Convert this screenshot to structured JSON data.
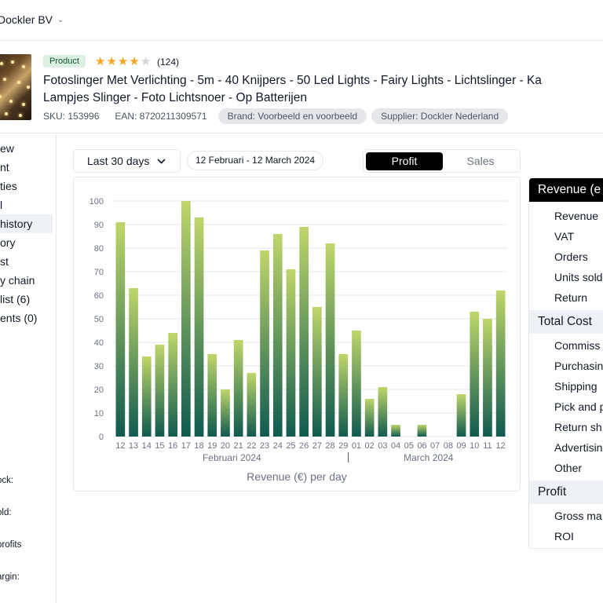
{
  "topbar": {
    "company": "Dockler BV"
  },
  "product": {
    "badge": "Product",
    "rating": 4,
    "rating_max": 5,
    "reviews": "(124)",
    "title_line1": "Fotoslinger Met Verlichting - 5m - 40 Knijpers - 50 Led Lights - Fairy Lights - Lichtslinger - Ka",
    "title_line2": "Lampjes Slinger - Foto Lichtsnoer - Op Batterijen",
    "sku": "SKU: 153996",
    "ean": "EAN: 8720211309571",
    "brand": "Brand: Voorbeeld en voorbeeld",
    "supplier": "Supplier: Dockler Nederland"
  },
  "sidebar": {
    "items": [
      {
        "label": "ew"
      },
      {
        "label": "nt"
      },
      {
        "label": "ties"
      },
      {
        "label": "l"
      },
      {
        "label": "history",
        "active": true
      },
      {
        "label": "ory"
      },
      {
        "label": "st"
      },
      {
        "label": "y chain"
      },
      {
        "label": "list (6)"
      },
      {
        "label": "ents (0)"
      }
    ],
    "stats": [
      {
        "label": "ock:"
      },
      {
        "label": "old:"
      },
      {
        "label": "profits"
      },
      {
        "label": "argin:"
      }
    ]
  },
  "controls": {
    "range_label": "Last 30 days",
    "date_range": "12 Februari - 12 March 2024",
    "toggle_profit": "Profit",
    "toggle_sales": "Sales"
  },
  "chart_data": {
    "type": "bar",
    "title": "",
    "xlabel": "Revenue (€) per day",
    "ylabel": "",
    "ylim": [
      0,
      100
    ],
    "yticks": [
      0,
      10,
      20,
      30,
      40,
      50,
      60,
      70,
      80,
      90,
      100
    ],
    "grid": true,
    "months": [
      "Februari 2024",
      "March 2024"
    ],
    "categories": [
      "12",
      "13",
      "14",
      "15",
      "16",
      "17",
      "18",
      "19",
      "20",
      "21",
      "22",
      "23",
      "24",
      "25",
      "26",
      "27",
      "28",
      "29",
      "01",
      "02",
      "03",
      "04",
      "05",
      "06",
      "07",
      "08",
      "09",
      "10",
      "11",
      "12"
    ],
    "values": [
      91,
      63,
      34,
      39,
      44,
      100,
      93,
      35,
      20,
      41,
      27,
      79,
      86,
      71,
      89,
      55,
      82,
      35,
      45,
      16,
      21,
      5,
      0,
      5,
      0,
      0,
      18,
      53,
      50,
      62
    ],
    "colors": {
      "top": "#bfd66a",
      "bottom": "#0f5a4f"
    }
  },
  "summary": {
    "revenue_head": "Revenue (e",
    "revenue_rows": [
      "Revenue",
      "VAT",
      "Orders",
      "Units sold",
      "Return"
    ],
    "cost_head": "Total Cost",
    "cost_rows": [
      "Commiss",
      "Purchasin",
      "Shipping",
      "Pick and p",
      "Return sh",
      "Advertisin",
      "Other"
    ],
    "profit_head": "Profit",
    "profit_rows": [
      "Gross ma",
      "ROI"
    ]
  }
}
